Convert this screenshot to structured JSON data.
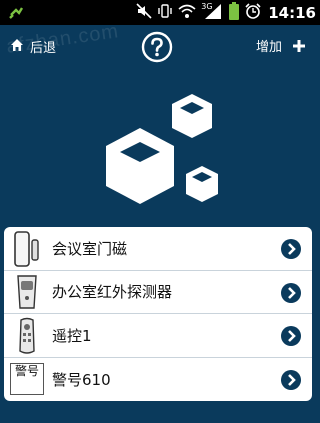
{
  "status_bar": {
    "time": "14:16",
    "network_label": "3G",
    "icons": [
      "usb-debug-icon",
      "mute-icon",
      "vibrate-icon",
      "wifi-icon",
      "signal-icon",
      "battery-icon",
      "alarm-icon"
    ]
  },
  "watermark": "afzhan.com",
  "header": {
    "back_label": "后退",
    "help_icon": "help-icon",
    "add_label": "增加"
  },
  "devices": [
    {
      "label": "会议室门磁",
      "icon": "door-sensor-icon"
    },
    {
      "label": "办公室红外探测器",
      "icon": "infrared-detector-icon"
    },
    {
      "label": "遥控1",
      "icon": "remote-control-icon"
    },
    {
      "label": "警号610",
      "icon": "alarm-siren-icon",
      "icon_text": "警号"
    }
  ],
  "colors": {
    "background": "#0a3a5c",
    "arrow": "#0a3a5c",
    "list_bg": "#ffffff"
  }
}
